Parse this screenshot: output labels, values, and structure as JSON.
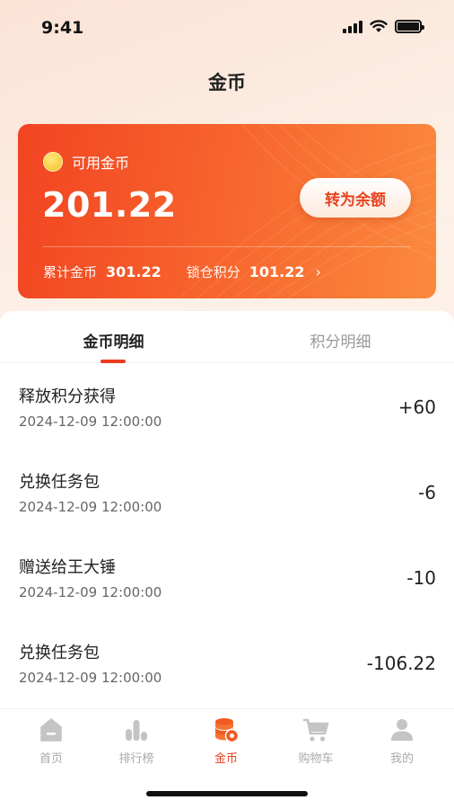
{
  "status": {
    "time": "9:41"
  },
  "header": {
    "title": "金币"
  },
  "card": {
    "label": "可用金币",
    "amount": "201.22",
    "convert_button": "转为余额",
    "total_label": "累计金币",
    "total_value": "301.22",
    "locked_label": "锁仓积分",
    "locked_value": "101.22",
    "arrow": "›"
  },
  "tabs": [
    {
      "label": "金币明细",
      "active": true
    },
    {
      "label": "积分明细",
      "active": false
    }
  ],
  "records": [
    {
      "title": "释放积分获得",
      "time": "2024-12-09 12:00:00",
      "amount": "+60"
    },
    {
      "title": "兑换任务包",
      "time": "2024-12-09 12:00:00",
      "amount": "-6"
    },
    {
      "title": "赠送给王大锤",
      "time": "2024-12-09 12:00:00",
      "amount": "-10"
    },
    {
      "title": "兑换任务包",
      "time": "2024-12-09 12:00:00",
      "amount": "-106.22"
    }
  ],
  "nav": [
    {
      "label": "首页",
      "icon": "home-icon"
    },
    {
      "label": "排行榜",
      "icon": "ranking-icon"
    },
    {
      "label": "金币",
      "icon": "coins-icon",
      "active": true
    },
    {
      "label": "购物车",
      "icon": "cart-icon"
    },
    {
      "label": "我的",
      "icon": "profile-icon"
    }
  ],
  "colors": {
    "accent": "#ec3d1e",
    "card_start": "#f24422",
    "card_end": "#fb8a3d",
    "inactive": "#aaaaaa"
  }
}
